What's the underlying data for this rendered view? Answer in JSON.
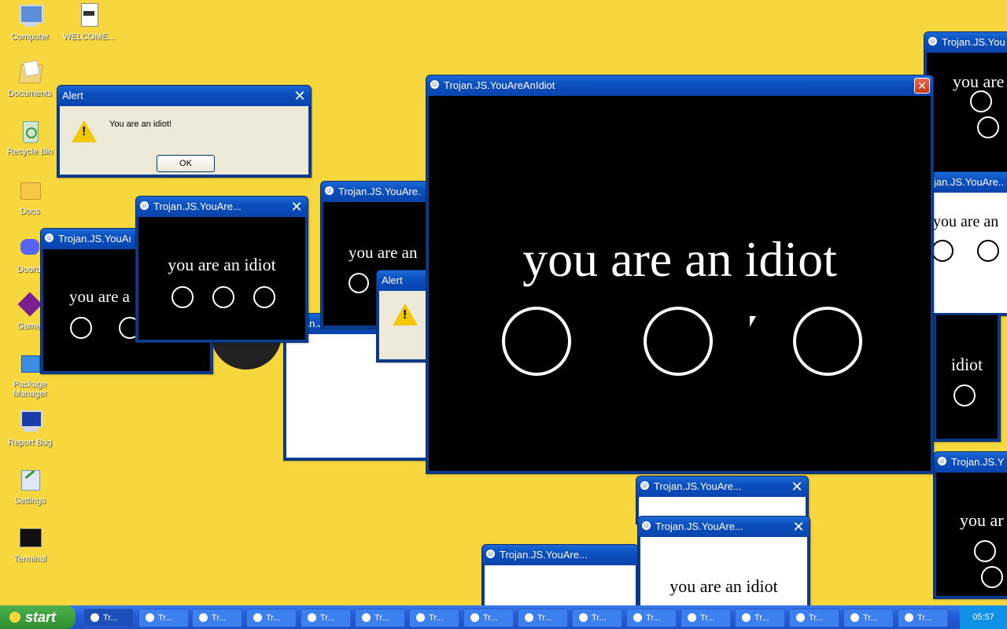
{
  "desktop": {
    "icons": [
      {
        "label": "Computer",
        "icon": "computer-icon"
      },
      {
        "label": "WELCOME...",
        "icon": "document-icon"
      },
      {
        "label": "Documents",
        "icon": "documents-icon"
      },
      {
        "label": "Recycle Bin",
        "icon": "recycle-bin-icon"
      },
      {
        "label": "Docs",
        "icon": "folder-icon"
      },
      {
        "label": "Doordi",
        "icon": "discord-icon"
      },
      {
        "label": "Gamei",
        "icon": "games-icon"
      },
      {
        "label": "Package Manager",
        "icon": "package-icon"
      },
      {
        "label": "Report Bug",
        "icon": "report-bug-icon"
      },
      {
        "label": "Settings",
        "icon": "settings-icon"
      },
      {
        "label": "Terminal",
        "icon": "terminal-icon"
      }
    ]
  },
  "alert1": {
    "title": "Alert",
    "message": "You are an idiot!",
    "ok": "OK"
  },
  "alert2": {
    "title": "Alert"
  },
  "main_window": {
    "title": "Trojan.JS.YouAreAnIdiot",
    "text": "you are an idiot",
    "close": "✕"
  },
  "windows": {
    "w_short_title": "Trojan.JS.YouAre...",
    "w_short_title2": "Trojan.JS.YouAre.",
    "w_short_title3": "Trojan.JS.YouAı",
    "w_right_title": "Trojan.JS.You",
    "w_right_title2": "Trojan.JS.Y",
    "text": "you are an idiot",
    "text_partial_a": "you are a",
    "text_partial_b": "you are an",
    "text_partial_c": "you are",
    "text_partial_d": "idiot",
    "text_partial_e": "you ar",
    "right_mid_title": "jan.JS.YouAre.."
  },
  "taskbar": {
    "start": "start",
    "item_label": "Tr...",
    "clock": "05:57"
  },
  "colors": {
    "desktop": "#f6d83e",
    "title_blue": "#0b4fbf",
    "start_green": "#2f8d2f"
  }
}
